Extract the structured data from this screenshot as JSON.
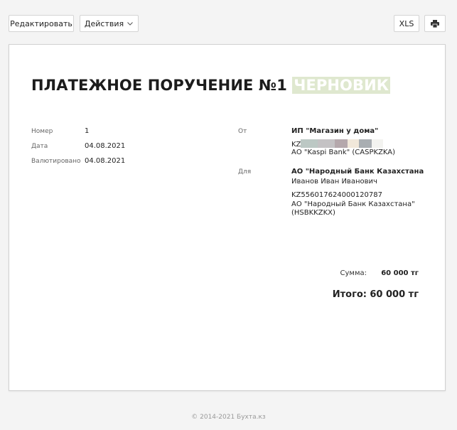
{
  "toolbar": {
    "edit_label": "Редактировать",
    "actions_label": "Действия",
    "xls_label": "XLS"
  },
  "document": {
    "title": "ПЛАТЕЖНОЕ ПОРУЧЕНИЕ №1",
    "status_badge": "ЧЕРНОВИК",
    "fields": {
      "number_label": "Номер",
      "number_value": "1",
      "date_label": "Дата",
      "date_value": "04.08.2021",
      "valued_label": "Валютировано",
      "valued_value": "04.08.2021"
    },
    "from": {
      "label": "От",
      "name": "ИП \"Магазин у дома\"",
      "account_prefix": "KZ",
      "bank": "АО \"Kaspi Bank\" (CASPKZKA)"
    },
    "to": {
      "label": "Для",
      "name": "АО \"Народный Банк Казахстана",
      "person": "Иванов Иван Иванович",
      "account": "KZ556017624000120787",
      "bank_line1": "АО \"Народный Банк Казахстана\"",
      "bank_line2": "(HSBKKZKX)"
    },
    "summary": {
      "sum_label": "Сумма:",
      "sum_value": "60 000 тг",
      "total_label": "Итого:",
      "total_value": "60 000 тг"
    }
  },
  "footer": {
    "copyright": "© 2014-2021 Бухта.кз"
  },
  "colors": {
    "badge_bg": "#dfe8cf",
    "page_bg": "#f4f4f4"
  }
}
